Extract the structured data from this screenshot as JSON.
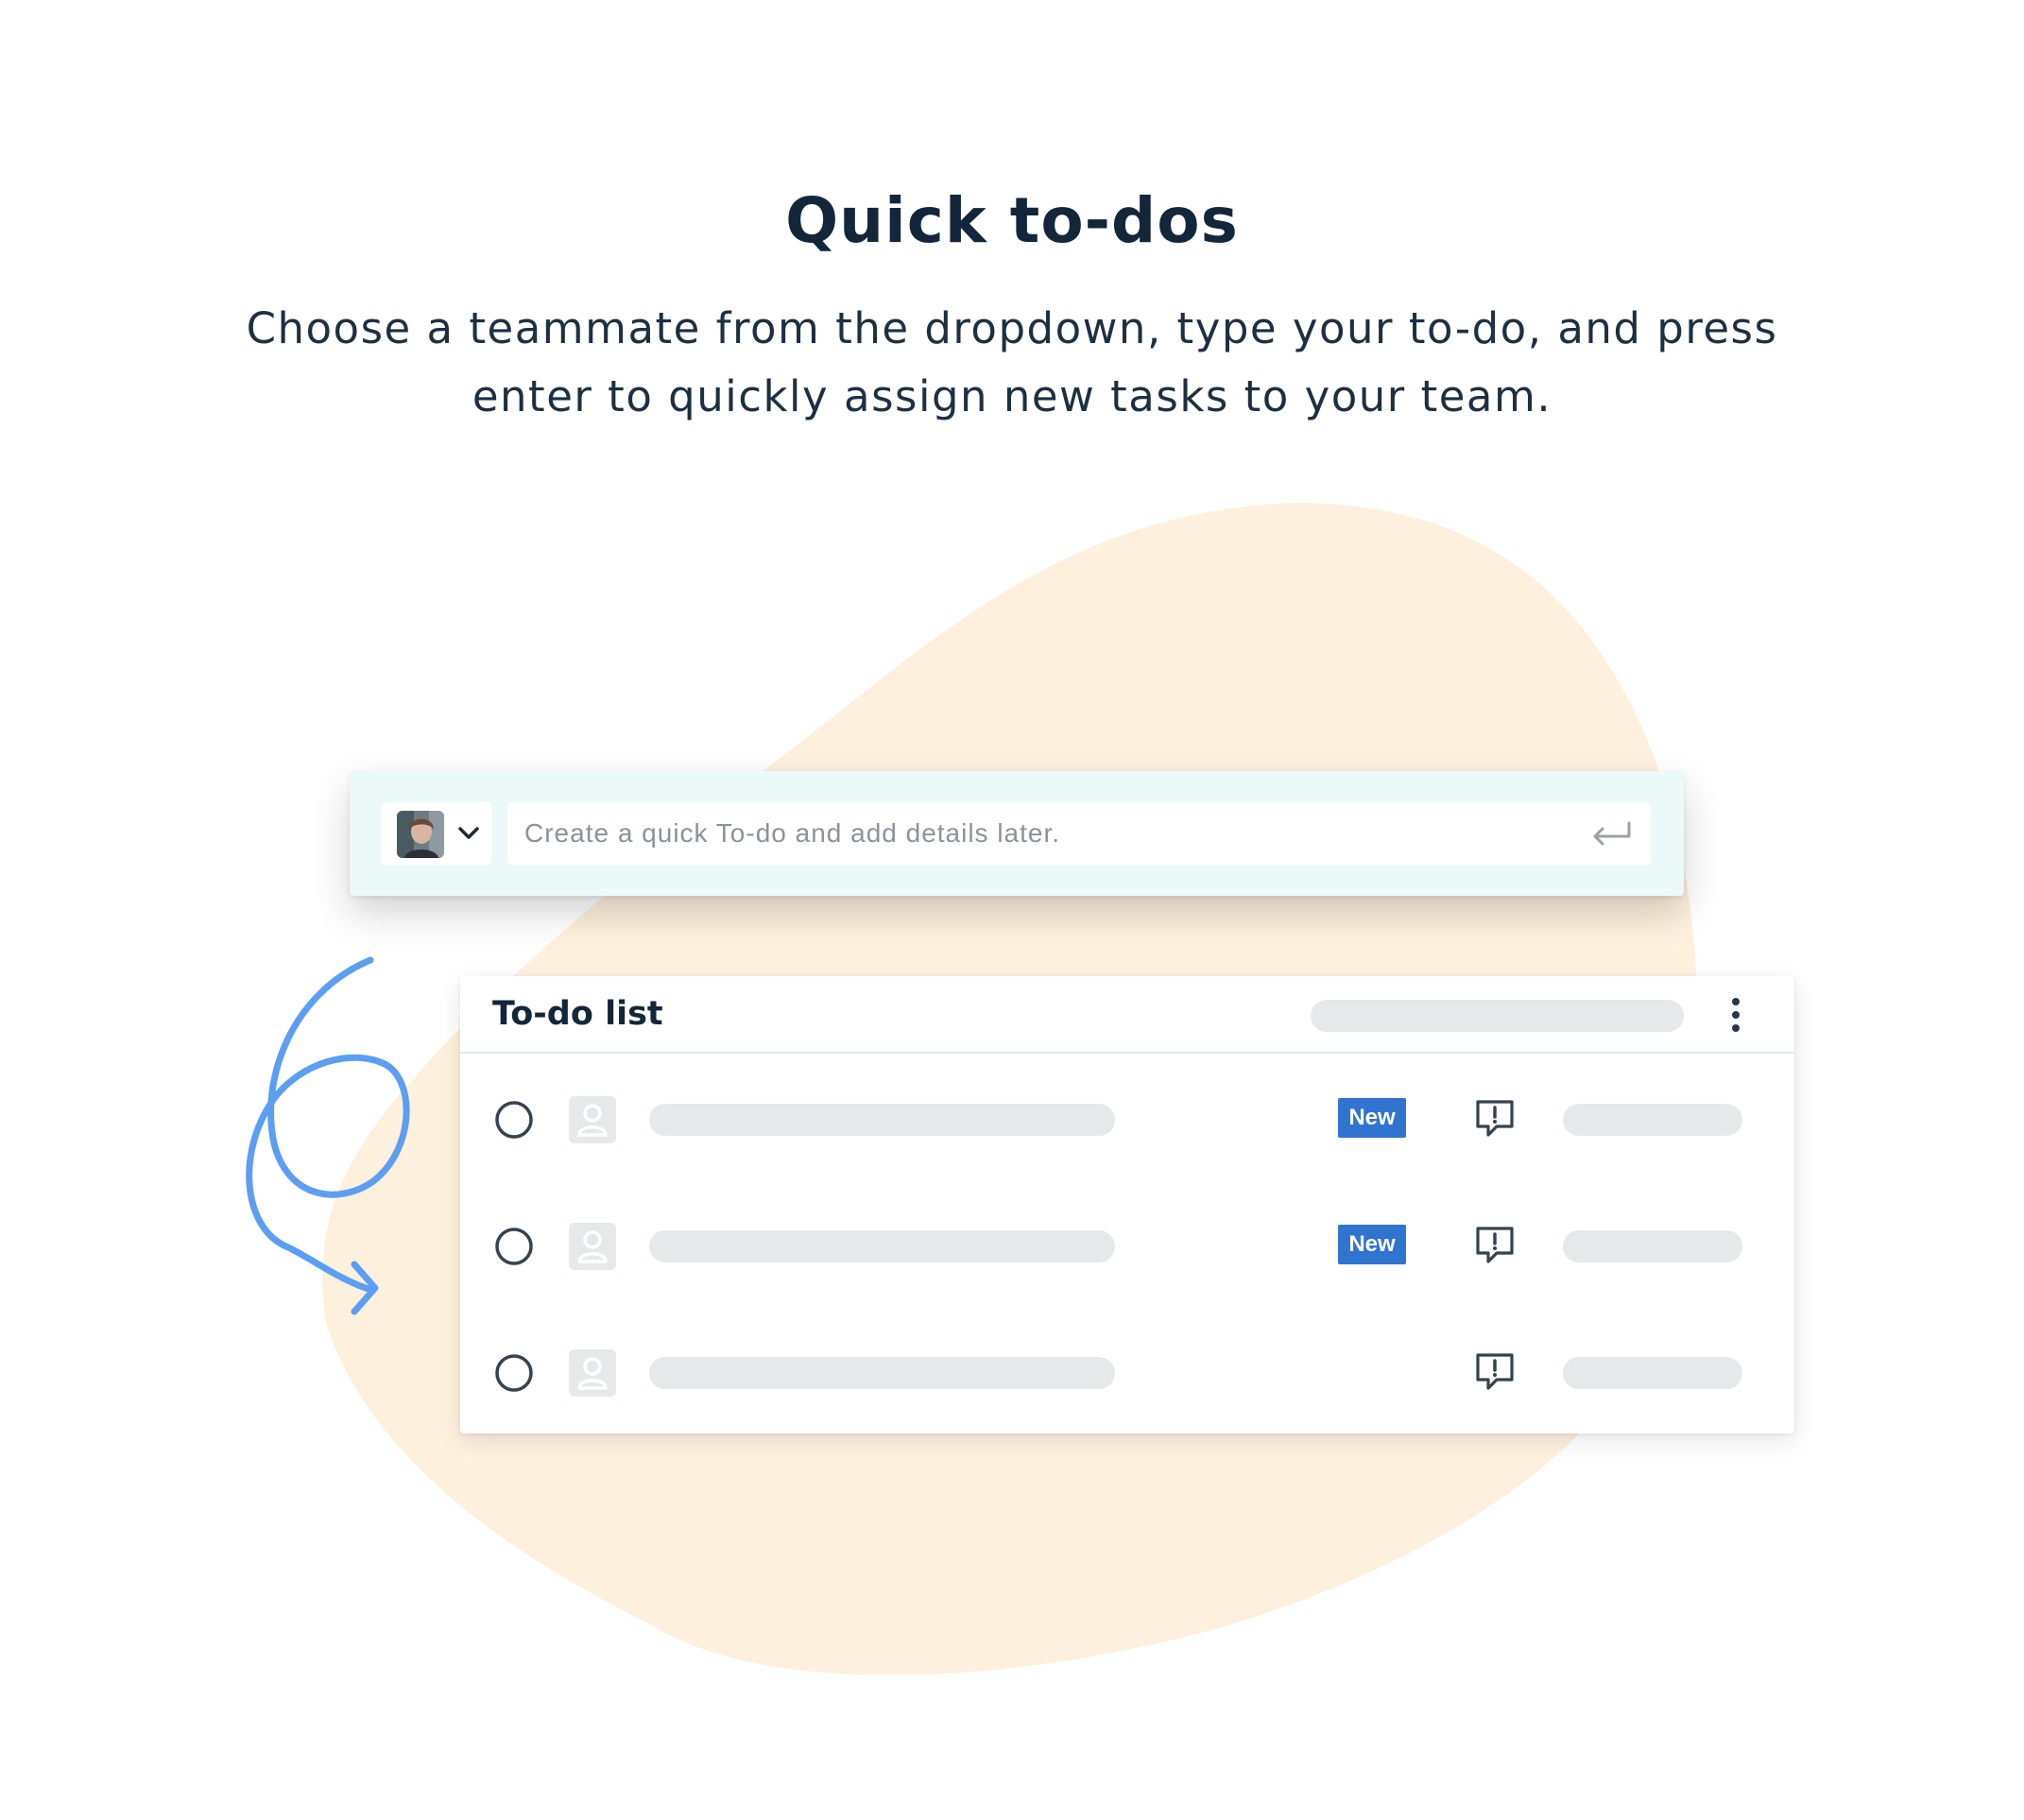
{
  "page": {
    "heading": "Quick to-dos",
    "subtext_line1": "Choose a teammate from the dropdown, type your to-do, and press",
    "subtext_line2": "enter to quickly assign new tasks to your team."
  },
  "composer": {
    "placeholder": "Create a quick To-do and add details later."
  },
  "todo_list": {
    "title": "To-do list",
    "rows": [
      {
        "badge": "New"
      },
      {
        "badge": "New"
      },
      {
        "badge": ""
      }
    ]
  },
  "colors": {
    "blob": "#fdf0dd",
    "composer_bg": "#ebf9f8",
    "badge": "#2f74cf",
    "swirl": "#5b9ef2",
    "placeholder_bar": "#e6e9ea"
  },
  "icons": {
    "chevron": "chevron-down-icon",
    "enter": "enter-return-icon",
    "more": "more-vertical-icon",
    "checkbox": "circle-checkbox-icon",
    "person": "person-placeholder-icon",
    "comment": "comment-alert-icon",
    "arrow": "curly-arrow-icon"
  }
}
